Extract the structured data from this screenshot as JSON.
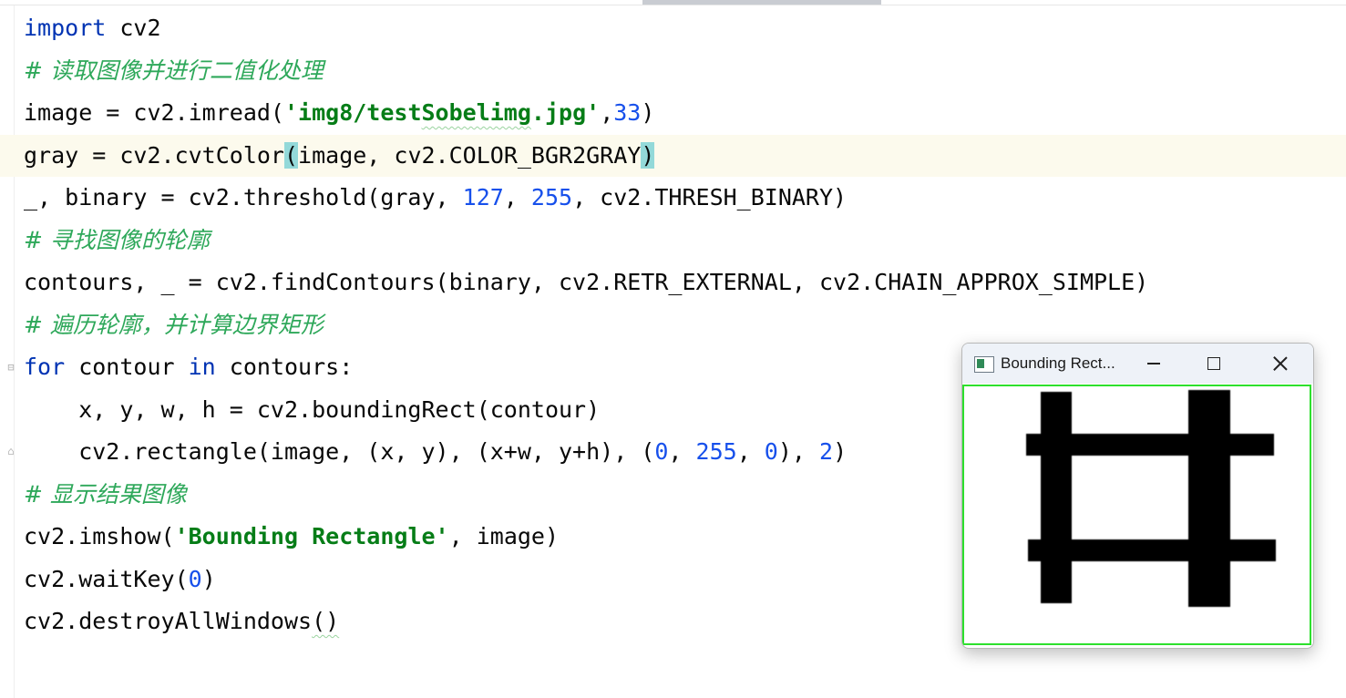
{
  "editor": {
    "lines": [
      [
        "import",
        " cv2"
      ],
      [
        "# 读取图像并进行二值化处理"
      ],
      [
        "image = cv2.imread(",
        "'img8/test",
        "Sobelimg",
        ".jpg'",
        ",",
        "33",
        ")"
      ],
      [
        "gray = cv2.cvtColor",
        "(",
        "image, cv2.COLOR_BGR2GRAY",
        ")"
      ],
      [
        "_, binary = cv2.threshold(gray, ",
        "127",
        ", ",
        "255",
        ", cv2.THRESH_BINARY)"
      ],
      [
        "# 寻找图像的轮廓"
      ],
      [
        "contours, _ = cv2.findContours(binary, cv2.RETR_EXTERNAL, cv2.CHAIN_APPROX_SIMPLE)"
      ],
      [
        "# 遍历轮廓，并计算边界矩形"
      ],
      [
        "for",
        " contour ",
        "in",
        " contours:"
      ],
      [
        "    x, y, w, h = cv2.boundingRect(contour)"
      ],
      [
        "    cv2.rectangle(image, (x, y), (x+w, y+h), (",
        "0",
        ", ",
        "255",
        ", ",
        "0",
        "), ",
        "2",
        ")"
      ],
      [
        "# 显示结果图像"
      ],
      [
        "cv2.imshow(",
        "'Bounding Rectangle'",
        ", image)"
      ],
      [
        "cv2.waitKey(",
        "0",
        ")"
      ],
      [
        "cv2.destroyAllWindows",
        "()"
      ]
    ]
  },
  "cv_window": {
    "title": "Bounding Rect...",
    "icon": "opencv-window-icon",
    "border_color": "#2de02d"
  },
  "colors": {
    "keyword": "#0033b3",
    "comment": "#2ea85a",
    "string": "#067d17",
    "number": "#1750eb",
    "current_line": "#fcfaed",
    "bracket_match": "#93d9d9"
  }
}
